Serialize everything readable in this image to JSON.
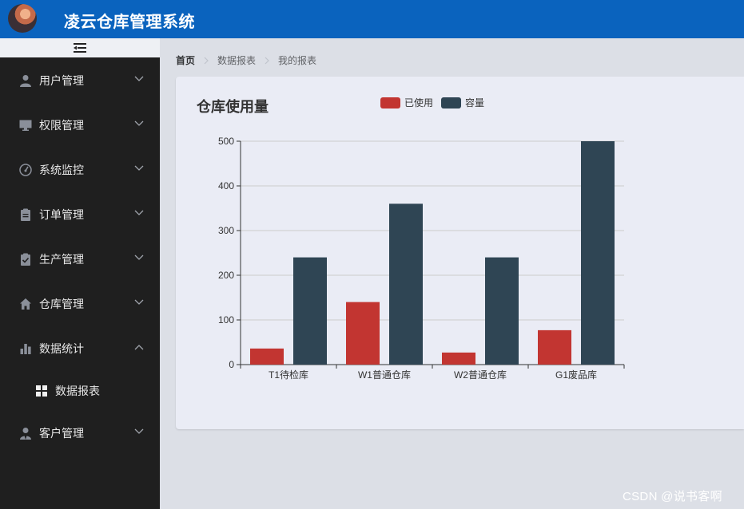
{
  "header": {
    "app_title": "凌云仓库管理系统"
  },
  "sidebar": {
    "items": [
      {
        "label": "用户管理",
        "icon": "user-icon",
        "expanded": false
      },
      {
        "label": "权限管理",
        "icon": "monitor-icon",
        "expanded": false
      },
      {
        "label": "系统监控",
        "icon": "gauge-icon",
        "expanded": false
      },
      {
        "label": "订单管理",
        "icon": "clipboard-icon",
        "expanded": false
      },
      {
        "label": "生产管理",
        "icon": "clipboard-check-icon",
        "expanded": false
      },
      {
        "label": "仓库管理",
        "icon": "home-icon",
        "expanded": false
      },
      {
        "label": "数据统计",
        "icon": "bar-chart-icon",
        "expanded": true
      },
      {
        "label": "数据报表",
        "icon": "grid-icon",
        "sub": true,
        "active": true
      },
      {
        "label": "客户管理",
        "icon": "customer-icon",
        "expanded": false
      }
    ]
  },
  "breadcrumb": [
    "首页",
    "数据报表",
    "我的报表"
  ],
  "colors": {
    "header": "#0a63be",
    "sidebar": "#1f1f1f",
    "used": "#c23531",
    "capacity": "#2f4554"
  },
  "chart_data": {
    "type": "bar",
    "title": "仓库使用量",
    "categories": [
      "T1待检库",
      "W1普通仓库",
      "W2普通仓库",
      "G1废品库"
    ],
    "series": [
      {
        "name": "已使用",
        "values": [
          36,
          140,
          27,
          77
        ],
        "color": "#c23531"
      },
      {
        "name": "容量",
        "values": [
          240,
          360,
          240,
          500
        ],
        "color": "#2f4554"
      }
    ],
    "ylim": [
      0,
      500
    ],
    "yticks": [
      0,
      100,
      200,
      300,
      400,
      500
    ],
    "grid": true,
    "legend_position": "top"
  },
  "watermark": "CSDN @说书客啊"
}
